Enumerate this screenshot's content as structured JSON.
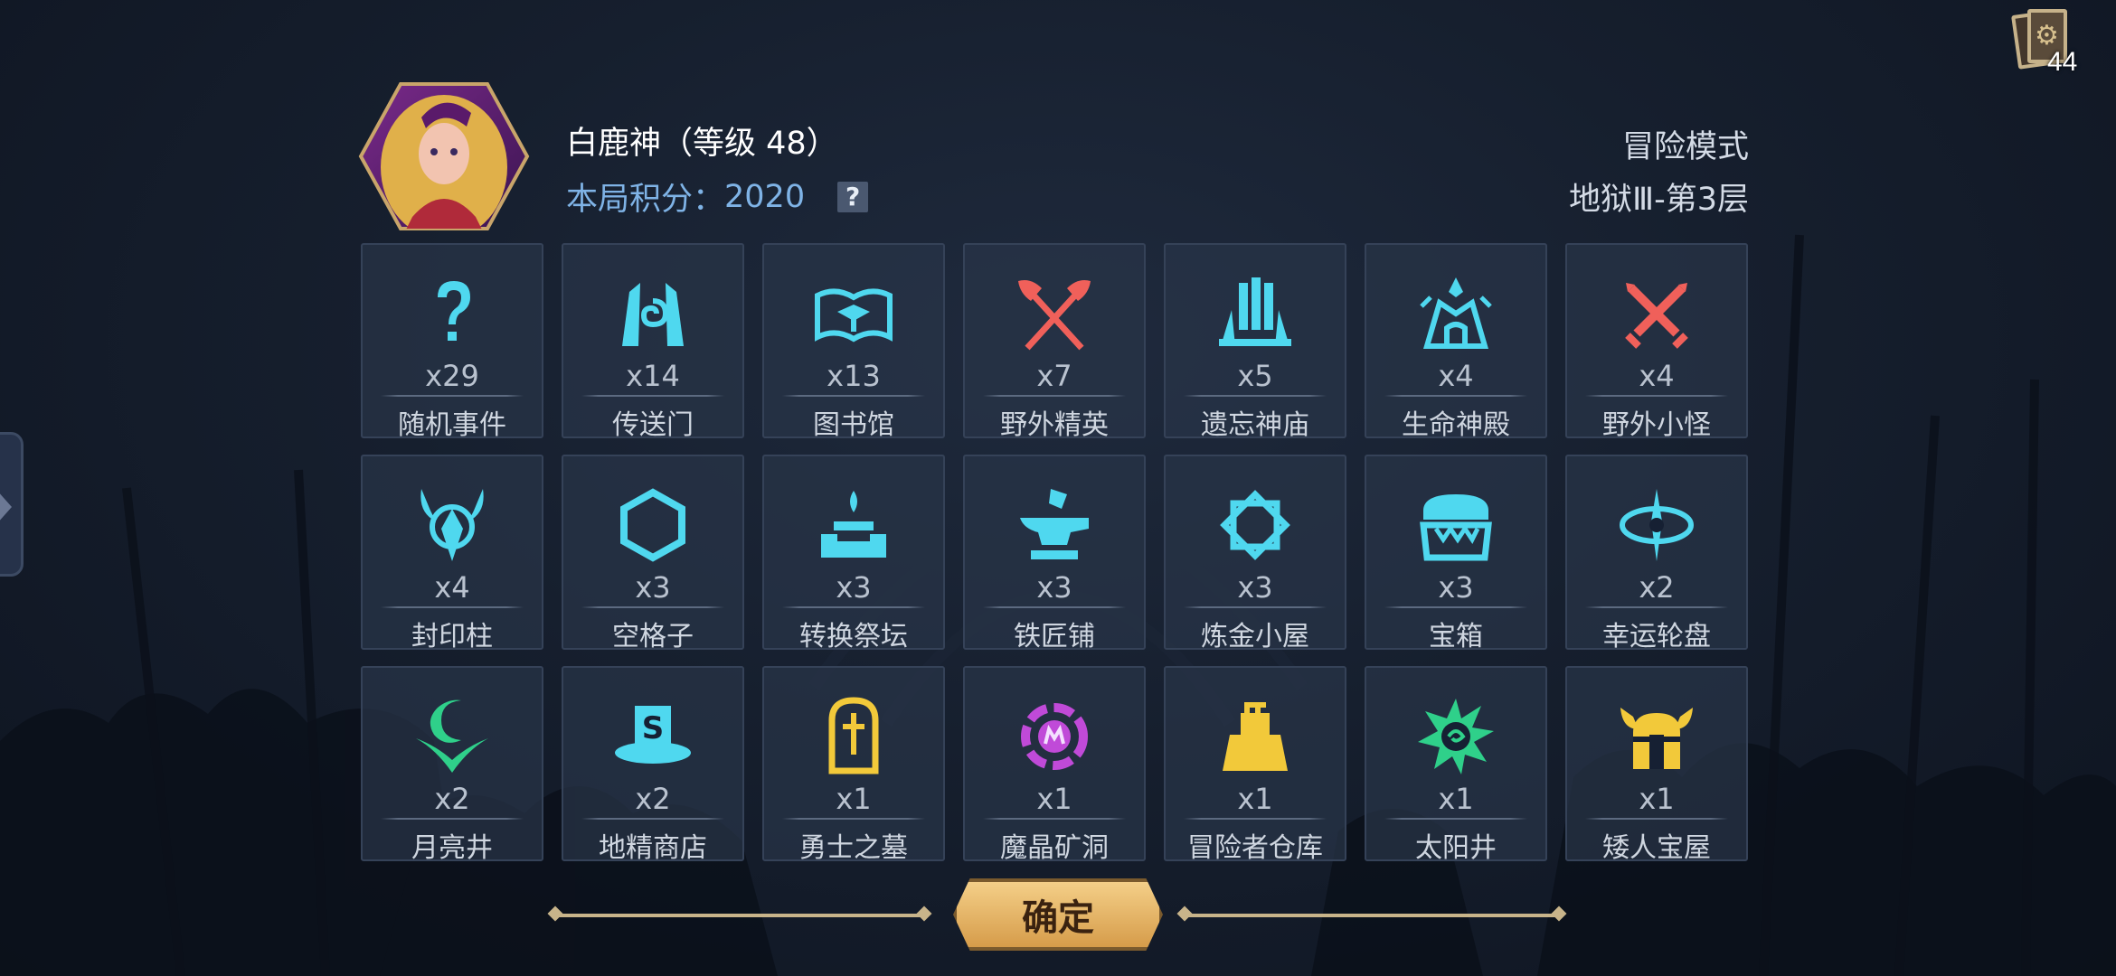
{
  "header": {
    "hero_name": "白鹿神（等级 48）",
    "score_label": "本局积分：",
    "score_value": "2020",
    "help": "?",
    "mode": "冒险模式",
    "floor": "地狱Ⅲ-第3层"
  },
  "deck": {
    "count": "44"
  },
  "tiles": [
    {
      "icon": "question-icon",
      "count": "x29",
      "label": "随机事件"
    },
    {
      "icon": "portal-icon",
      "count": "x14",
      "label": "传送门"
    },
    {
      "icon": "book-icon",
      "count": "x13",
      "label": "图书馆"
    },
    {
      "icon": "crossed-axes-icon",
      "count": "x7",
      "label": "野外精英"
    },
    {
      "icon": "temple-icon",
      "count": "x5",
      "label": "遗忘神庙"
    },
    {
      "icon": "life-shrine-icon",
      "count": "x4",
      "label": "生命神殿"
    },
    {
      "icon": "crossed-swords-icon",
      "count": "x4",
      "label": "野外小怪"
    },
    {
      "icon": "seal-pillar-icon",
      "count": "x4",
      "label": "封印柱"
    },
    {
      "icon": "hexagon-icon",
      "count": "x3",
      "label": "空格子"
    },
    {
      "icon": "altar-icon",
      "count": "x3",
      "label": "转换祭坛"
    },
    {
      "icon": "anvil-icon",
      "count": "x3",
      "label": "铁匠铺"
    },
    {
      "icon": "alchemy-icon",
      "count": "x3",
      "label": "炼金小屋"
    },
    {
      "icon": "chest-icon",
      "count": "x3",
      "label": "宝箱"
    },
    {
      "icon": "wheel-icon",
      "count": "x2",
      "label": "幸运轮盘"
    },
    {
      "icon": "moon-well-icon",
      "count": "x2",
      "label": "月亮井"
    },
    {
      "icon": "gnome-shop-icon",
      "count": "x2",
      "label": "地精商店"
    },
    {
      "icon": "tomb-icon",
      "count": "x1",
      "label": "勇士之墓"
    },
    {
      "icon": "crystal-mine-icon",
      "count": "x1",
      "label": "魔晶矿洞"
    },
    {
      "icon": "warehouse-icon",
      "count": "x1",
      "label": "冒险者仓库"
    },
    {
      "icon": "sun-well-icon",
      "count": "x1",
      "label": "太阳井"
    },
    {
      "icon": "dwarf-treasury-icon",
      "count": "x1",
      "label": "矮人宝屋"
    }
  ],
  "footer": {
    "confirm_label": "确定"
  },
  "colors": {
    "cyan": "#4fd8ef",
    "red": "#f0605a",
    "magenta": "#c04ad8",
    "gold": "#f2c93a",
    "green": "#2fd08a",
    "accent_text": "#7fb3e6"
  }
}
